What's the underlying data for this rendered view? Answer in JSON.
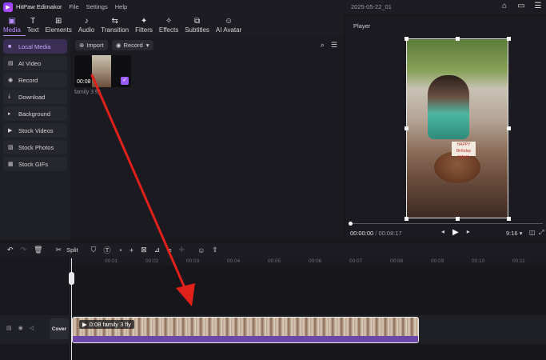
{
  "titlebar": {
    "app_name": "HitPaw Edimakor",
    "menu": [
      "File",
      "Settings",
      "Help"
    ],
    "project_title": "2025-05-22_01"
  },
  "toolbar": {
    "items": [
      {
        "label": "Media",
        "icon": "media-icon"
      },
      {
        "label": "Text",
        "icon": "text-icon"
      },
      {
        "label": "Elements",
        "icon": "elements-icon"
      },
      {
        "label": "Audio",
        "icon": "audio-icon"
      },
      {
        "label": "Transition",
        "icon": "transition-icon"
      },
      {
        "label": "Filters",
        "icon": "filters-icon"
      },
      {
        "label": "Effects",
        "icon": "effects-icon"
      },
      {
        "label": "Subtitles",
        "icon": "subtitles-icon"
      },
      {
        "label": "AI Avatar",
        "icon": "ai-avatar-icon"
      }
    ]
  },
  "sidebar": {
    "items": [
      {
        "label": "Local Media"
      },
      {
        "label": "AI Video"
      },
      {
        "label": "Record"
      },
      {
        "label": "Download"
      },
      {
        "label": "Background"
      },
      {
        "label": "Stock Videos"
      },
      {
        "label": "Stock Photos"
      },
      {
        "label": "Stock GIFs"
      }
    ]
  },
  "media": {
    "import_label": "Import",
    "record_label": "Record",
    "clip": {
      "duration": "00:08",
      "name": "family 3 fly"
    }
  },
  "player": {
    "title": "Player",
    "current_time": "00:00:00",
    "separator": "/",
    "total_time": "00:08:17",
    "aspect_ratio": "9:16",
    "video_text": "HAPPY Birthday MAHA"
  },
  "timeline": {
    "split_label": "Split",
    "ruler": [
      "00:01",
      "00:02",
      "00:03",
      "00:04",
      "00:05",
      "00:06",
      "00:07",
      "00:08",
      "00:09",
      "00:10",
      "00:11"
    ],
    "cover_label": "Cover",
    "clip_label": "0:08 family 3 fly"
  },
  "colors": {
    "accent": "#b98cff",
    "arrow": "#e0201a",
    "clip_bar": "#6b47a8"
  }
}
